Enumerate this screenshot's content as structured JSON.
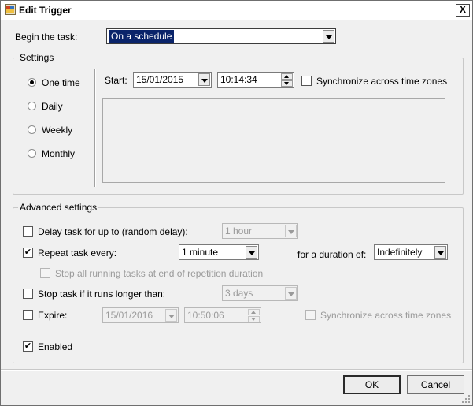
{
  "window": {
    "title": "Edit Trigger",
    "close_glyph": "X"
  },
  "begin": {
    "label": "Begin the task:",
    "value": "On a schedule"
  },
  "settings": {
    "legend": "Settings",
    "radios": [
      {
        "label": "One time",
        "checked": true
      },
      {
        "label": "Daily",
        "checked": false
      },
      {
        "label": "Weekly",
        "checked": false
      },
      {
        "label": "Monthly",
        "checked": false
      }
    ],
    "start_label": "Start:",
    "start_date": "15/01/2015",
    "start_time": "10:14:34",
    "sync_label": "Synchronize across time zones"
  },
  "advanced": {
    "legend": "Advanced settings",
    "delay_label": "Delay task for up to (random delay):",
    "delay_value": "1 hour",
    "repeat_label": "Repeat task every:",
    "repeat_value": "1 minute",
    "duration_label": "for a duration of:",
    "duration_value": "Indefinitely",
    "stop_all_label": "Stop all running tasks at end of repetition duration",
    "stop_longer_label": "Stop task if it runs longer than:",
    "stop_longer_value": "3 days",
    "expire_label": "Expire:",
    "expire_date": "15/01/2016",
    "expire_time": "10:50:06",
    "expire_sync_label": "Synchronize across time zones",
    "enabled_label": "Enabled",
    "check_glyph": "✔"
  },
  "buttons": {
    "ok": "OK",
    "cancel": "Cancel"
  }
}
